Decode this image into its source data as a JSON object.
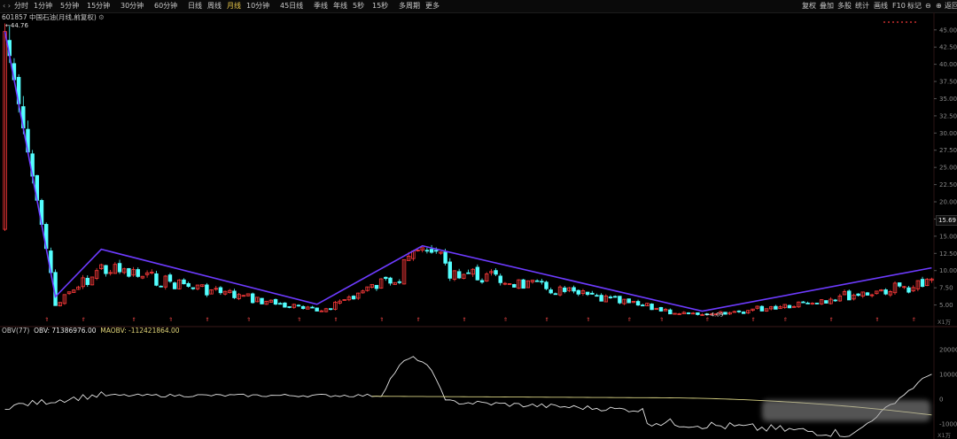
{
  "toolbar": {
    "items": [
      "分时",
      "1分钟",
      "5分钟",
      "15分钟",
      "30分钟",
      "60分钟",
      "日线",
      "周线",
      "月线",
      "10分钟",
      "45日线",
      "季线",
      "年线",
      "5秒",
      "15秒",
      "多周期",
      "更多"
    ],
    "active": "月线",
    "nav": "‹ ›",
    "right": [
      "复权",
      "叠加",
      "多股",
      "统计",
      "画线",
      "F10",
      "标记",
      "⊖",
      "⊕",
      "返回"
    ]
  },
  "stock": {
    "code": "601857",
    "name": "中国石油",
    "period_info": "(月线,前复权)"
  },
  "labels": {
    "max_price": "44.76",
    "min_price": "4.09",
    "last_price": "15.69",
    "price_unit": "X1万",
    "obv_unit": "X1万"
  },
  "obv_legend": {
    "title": "OBV(77)",
    "obv": "OBV: 71386976.00",
    "maobv": "MAOBV: -112421864.00"
  },
  "colors": {
    "up": "#ff3b3b",
    "down": "#54ffff",
    "trend": "#6d3bff",
    "obv": "#e6e6e6",
    "maobv": "#d8d283",
    "bg": "#000000"
  },
  "chart_data": {
    "type": "candlestick",
    "price_axis": {
      "ticks": [
        "45.00",
        "42.50",
        "40.00",
        "37.50",
        "35.00",
        "32.50",
        "30.00",
        "27.50",
        "25.00",
        "22.50",
        "20.00",
        "17.50",
        "15.00",
        "12.50",
        "10.00",
        "7.50",
        "5.00"
      ],
      "ylim": [
        2.5,
        46
      ]
    },
    "trendline_points": [
      {
        "i": 0,
        "p": 44.76
      },
      {
        "i": 11,
        "p": 6.2
      },
      {
        "i": 21,
        "p": 13.1
      },
      {
        "i": 68,
        "p": 5.1
      },
      {
        "i": 91,
        "p": 13.6
      },
      {
        "i": 152,
        "p": 4.1
      },
      {
        "i": 202,
        "p": 10.4
      }
    ],
    "obv_axis": {
      "ticks": [
        "20000",
        "10000",
        "0",
        "-10000"
      ],
      "ylim": [
        -16000,
        26000
      ]
    },
    "marker_count": 22
  }
}
